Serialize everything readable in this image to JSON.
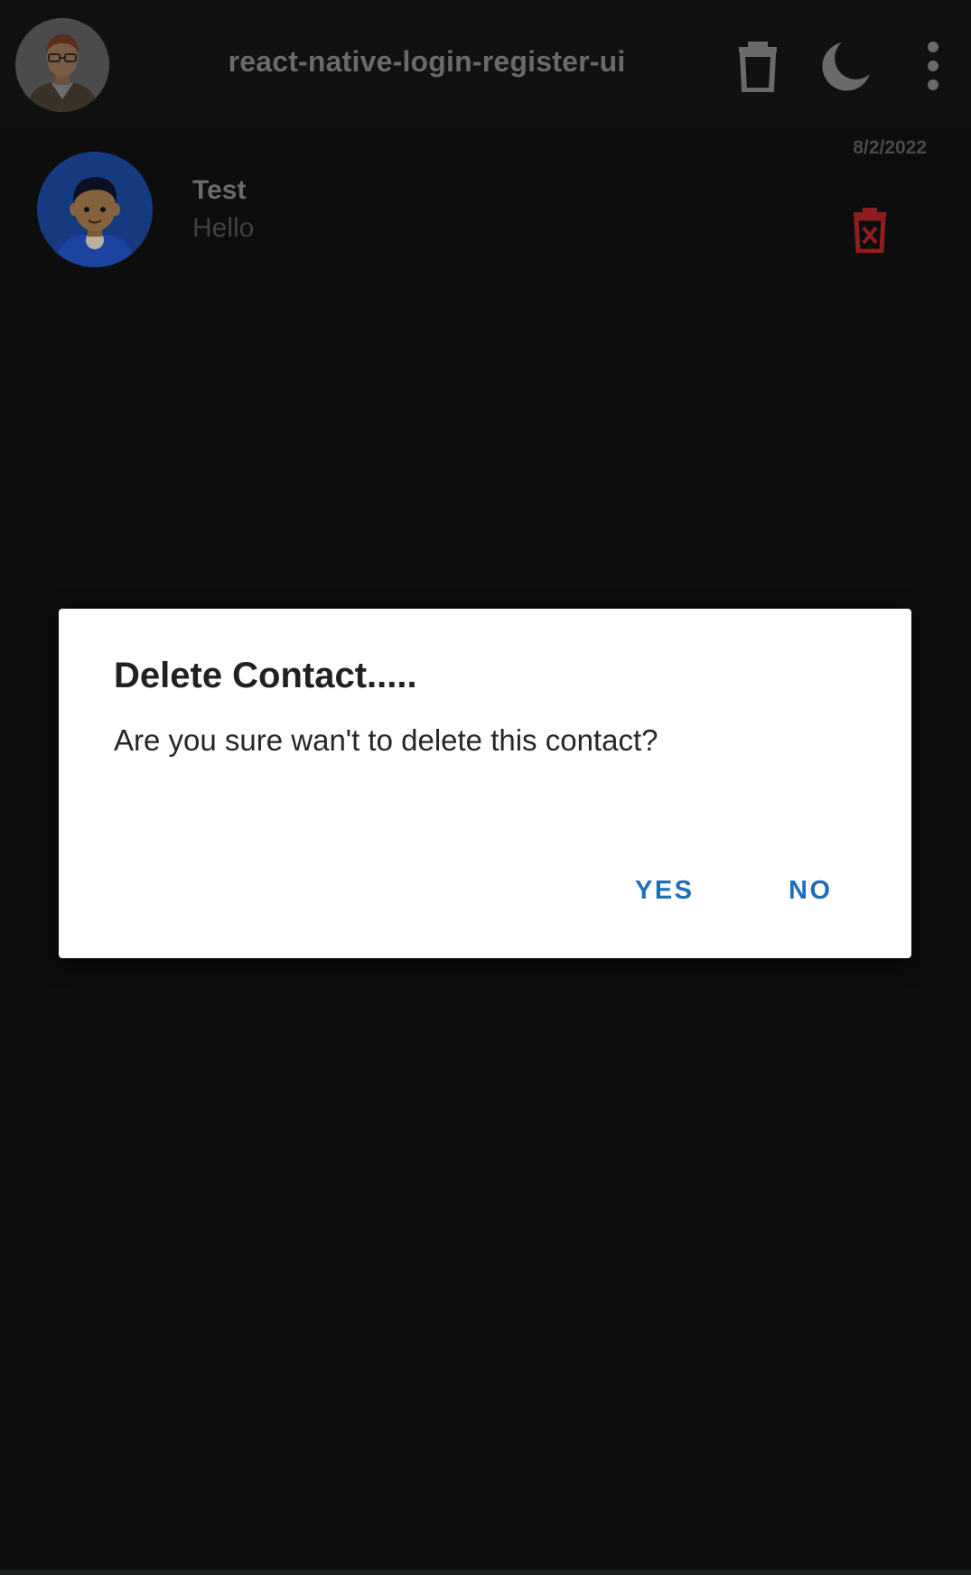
{
  "header": {
    "title": "react-native-login-register-ui",
    "profile_avatar": "profile-avatar-image",
    "delete_all_icon": "trash-icon",
    "theme_icon": "moon-icon",
    "more_icon": "more-vertical-icon"
  },
  "contacts": [
    {
      "name": "Test",
      "message": "Hello",
      "date": "8/2/2022",
      "avatar": "user-avatar-image",
      "delete_icon": "trash-x-icon"
    }
  ],
  "dialog": {
    "title": "Delete Contact.....",
    "message": "Are you sure wan't to delete this contact?",
    "yes_label": "YES",
    "no_label": "NO"
  },
  "colors": {
    "background": "#0d0d0d",
    "app_bar": "#111111",
    "dialog_bg": "#ffffff",
    "accent": "#1e6fb5",
    "delete_red": "#8e1e1e"
  }
}
